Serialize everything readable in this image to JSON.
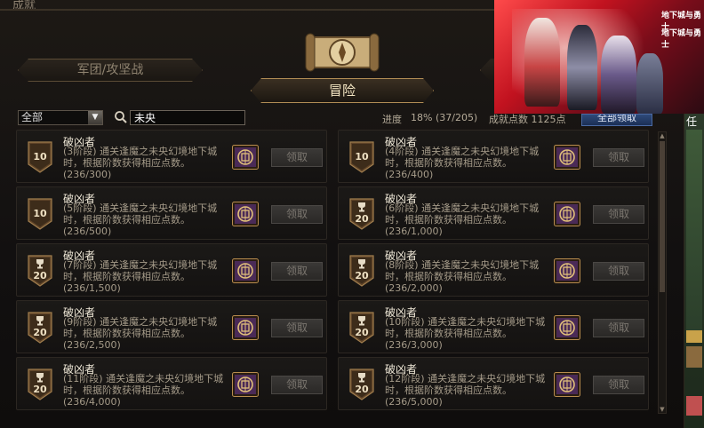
{
  "window": {
    "title": "成就"
  },
  "tabs": {
    "left": "军团/攻坚战",
    "active": "冒险"
  },
  "filter": {
    "category": "全部",
    "search_value": "未央"
  },
  "progress": {
    "label": "进度",
    "value": "18% (37/205)",
    "points": "成就点数 1125点"
  },
  "claim_all": {
    "label": "全部领取"
  },
  "claim_label": "领取",
  "cards": [
    {
      "title": "破凶者",
      "desc": "(3阶段) 通关逢魔之未央幻境地下城时，根据阶数获得相应点数。",
      "count": "(236/300)",
      "badge": "10",
      "cup": false
    },
    {
      "title": "破凶者",
      "desc": "(4阶段) 通关逢魔之未央幻境地下城时，根据阶数获得相应点数。",
      "count": "(236/400)",
      "badge": "10",
      "cup": false
    },
    {
      "title": "破凶者",
      "desc": "(5阶段) 通关逢魔之未央幻境地下城时，根据阶数获得相应点数。",
      "count": "(236/500)",
      "badge": "10",
      "cup": false
    },
    {
      "title": "破凶者",
      "desc": "(6阶段) 通关逢魔之未央幻境地下城时，根据阶数获得相应点数。",
      "count": "(236/1,000)",
      "badge": "20",
      "cup": true
    },
    {
      "title": "破凶者",
      "desc": "(7阶段) 通关逢魔之未央幻境地下城时，根据阶数获得相应点数。",
      "count": "(236/1,500)",
      "badge": "20",
      "cup": true
    },
    {
      "title": "破凶者",
      "desc": "(8阶段) 通关逢魔之未央幻境地下城时，根据阶数获得相应点数。",
      "count": "(236/2,000)",
      "badge": "20",
      "cup": true
    },
    {
      "title": "破凶者",
      "desc": "(9阶段) 通关逢魔之未央幻境地下城时，根据阶数获得相应点数。",
      "count": "(236/2,500)",
      "badge": "20",
      "cup": true
    },
    {
      "title": "破凶者",
      "desc": "(10阶段) 通关逢魔之未央幻境地下城时，根据阶数获得相应点数。",
      "count": "(236/3,000)",
      "badge": "20",
      "cup": true
    },
    {
      "title": "破凶者",
      "desc": "(11阶段) 通关逢魔之未央幻境地下城时，根据阶数获得相应点数。",
      "count": "(236/4,000)",
      "badge": "20",
      "cup": true
    },
    {
      "title": "破凶者",
      "desc": "(12阶段) 通关逢魔之未央幻境地下城时，根据阶数获得相应点数。",
      "count": "(236/5,000)",
      "badge": "20",
      "cup": true
    }
  ],
  "ad": {
    "logo_top": "地下城与勇士",
    "logo_bottom": "地下城与勇士"
  },
  "side": {
    "task_text": "任务"
  },
  "colors": {
    "accent_gold": "#b18c55",
    "badge_bronze": "#6b4e2e",
    "reward_purple": "#5a2a6e"
  }
}
